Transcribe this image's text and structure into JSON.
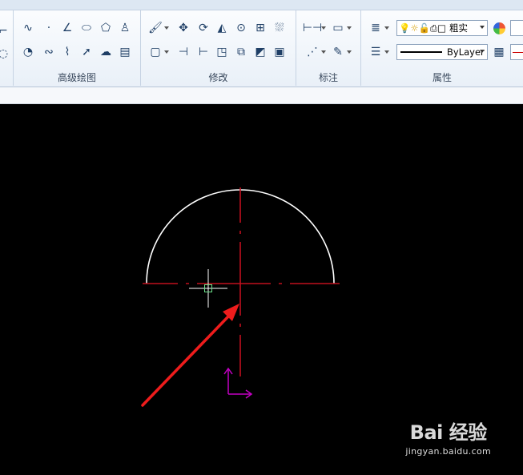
{
  "ribbon": {
    "panels": {
      "draw": "高级绘图",
      "modify": "修改",
      "annotate": "标注",
      "properties": "属性"
    },
    "properties": {
      "color_combo": "粗实",
      "linetype_combo": "ByLayer"
    }
  },
  "icons": {
    "draw": [
      "spline-icon",
      "point-icon",
      "angle-icon",
      "ellipse-icon",
      "polygon-icon",
      "user-icon",
      "pie-icon",
      "wave-icon",
      "zigzag-icon",
      "arrow-icon",
      "cloud-icon",
      "table-icon"
    ],
    "modify": [
      "brush-icon",
      "move-icon",
      "rotate-icon",
      "mirror-icon",
      "circle-target-icon",
      "array-icon",
      "hatch-icon",
      "rectangle-icon",
      "trim-icon",
      "extend-icon",
      "doc-icon",
      "copy-icon",
      "layer-icon",
      "save-icon"
    ],
    "annotate": [
      "dimension-icon",
      "text-block-icon",
      "leader-icon",
      "edit-icon"
    ],
    "properties": [
      "layer-stack-icon",
      "lightbulb-icon",
      "sun-icon",
      "lock-icon",
      "printer-icon",
      "square-icon",
      "color-wheel-icon",
      "lineweight-icon",
      "linestyle-icon"
    ]
  },
  "colors": {
    "arc": "#ffffff",
    "centerline": "#c0101e",
    "ucs": "#c200c2",
    "cursor": "#ffffff",
    "cursor_box": "#6ce08a",
    "annotation_arrow": "#ee1c1c"
  },
  "watermark": {
    "main": "Bai 经验",
    "sub": "jingyan.baidu.com"
  }
}
